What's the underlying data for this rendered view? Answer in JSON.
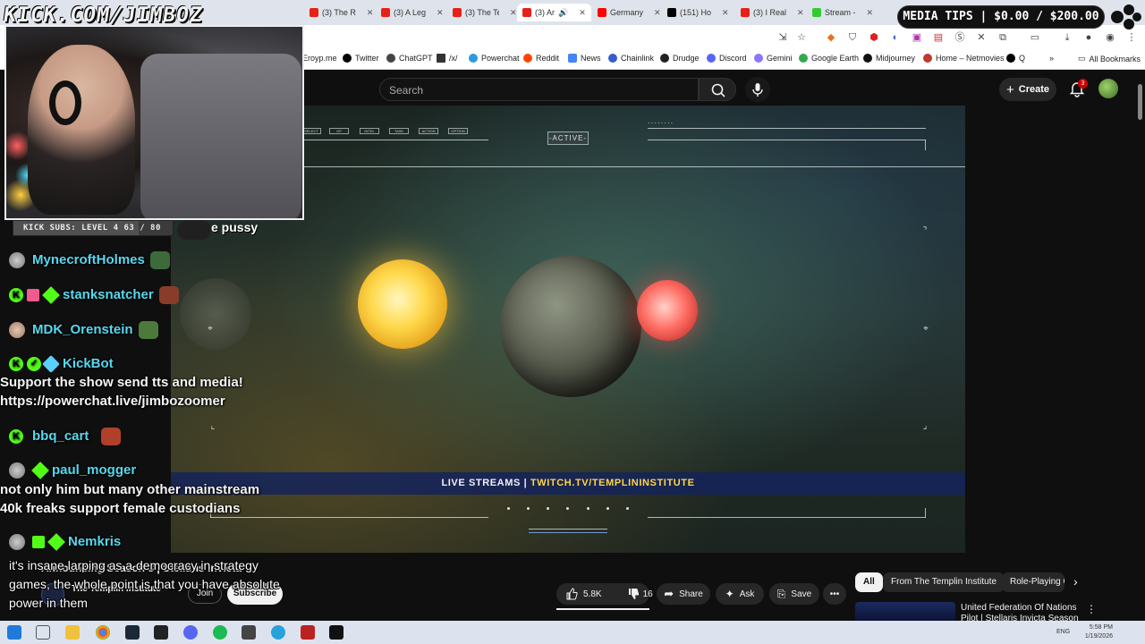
{
  "overlay": {
    "url_text": "KICK.COM/JIMBOZ",
    "kick_subs": "KICK SUBS: LEVEL 4 63 / 80",
    "sub_goal_progress": 0.7875,
    "donation_text": "e pussy",
    "media_tips": "MEDIA TIPS | $0.00 / $200.00",
    "caption": "it's insane larping as a democracy in strategy games, the whole point is that you have absolute power in them"
  },
  "browser": {
    "tabs": [
      {
        "label": "(3) The R",
        "icon": "youtube"
      },
      {
        "label": "(3) A Leg",
        "icon": "youtube"
      },
      {
        "label": "(3) The Te",
        "icon": "youtube"
      },
      {
        "label": "(3) Ar",
        "icon": "youtube",
        "active": true
      },
      {
        "label": "Germany",
        "icon": "youtube"
      },
      {
        "label": "(151) Ho",
        "icon": "x"
      },
      {
        "label": "(3) I Real",
        "icon": "youtube"
      },
      {
        "label": "Stream -",
        "icon": "kick"
      }
    ],
    "bookmarks": [
      "Eroyp.me",
      "Twitter",
      "ChatGPT",
      "/x/",
      "Powerchat",
      "Reddit",
      "News",
      "Chainlink",
      "Drudge",
      "Discord",
      "Gemini",
      "Google Earth",
      "Midjourney",
      "Home – Netmovies",
      "Q"
    ],
    "all_bookmarks": "All Bookmarks"
  },
  "youtube": {
    "search_placeholder": "Search",
    "create_label": "Create",
    "notification_count": "3",
    "video": {
      "hud_tabs": [
        "SELECT",
        "OP",
        "INTEL",
        "TASK",
        "ACTION",
        "OPTION"
      ],
      "active_badge": "-ACTIVE-",
      "banner_prefix": "LIVE STREAMS | ",
      "banner_highlight": "TWITCH.TV/TEMPLININSTITUTE"
    },
    "title": "Announcing Season 3 | Stellaris Invicta",
    "channel": "The Templin Institute",
    "join_label": "Join",
    "subscribe_label": "Subscribe",
    "likes": "5.8K",
    "dislikes": "16",
    "share_label": "Share",
    "ask_label": "Ask",
    "save_label": "Save",
    "chips": [
      "All",
      "From The Templin Institute",
      "Role-Playing G"
    ],
    "recommended_title": "United Federation Of Nations Pilot | Stellaris Invicta Season 3"
  },
  "chat": [
    {
      "user": "MynecroftHolmes",
      "badges": [
        "avatar"
      ],
      "emote": true
    },
    {
      "user": "stanksnatcher",
      "badges": [
        "kick",
        "gift",
        "diamond"
      ],
      "emote": true
    },
    {
      "user": "MDK_Orenstein",
      "badges": [
        "avatar"
      ],
      "emote": true
    },
    {
      "user": "KickBot",
      "badges": [
        "kick",
        "check",
        "wrench"
      ],
      "message": "Support the show send tts and media! https://powerchat.live/jimbozoomer"
    },
    {
      "user": "bbq_cart",
      "badges": [
        "kick"
      ],
      "emote": true
    },
    {
      "user": "paul_mogger",
      "badges": [
        "avatar",
        "diamond"
      ],
      "message": "not only him but many other mainstream 40k freaks support female custodians"
    },
    {
      "user": "Nemkris",
      "badges": [
        "avatar",
        "gift",
        "diamond"
      ]
    }
  ],
  "taskbar": {
    "lang": "ENG",
    "time": "5:58 PM",
    "date": "1/19/2026"
  }
}
